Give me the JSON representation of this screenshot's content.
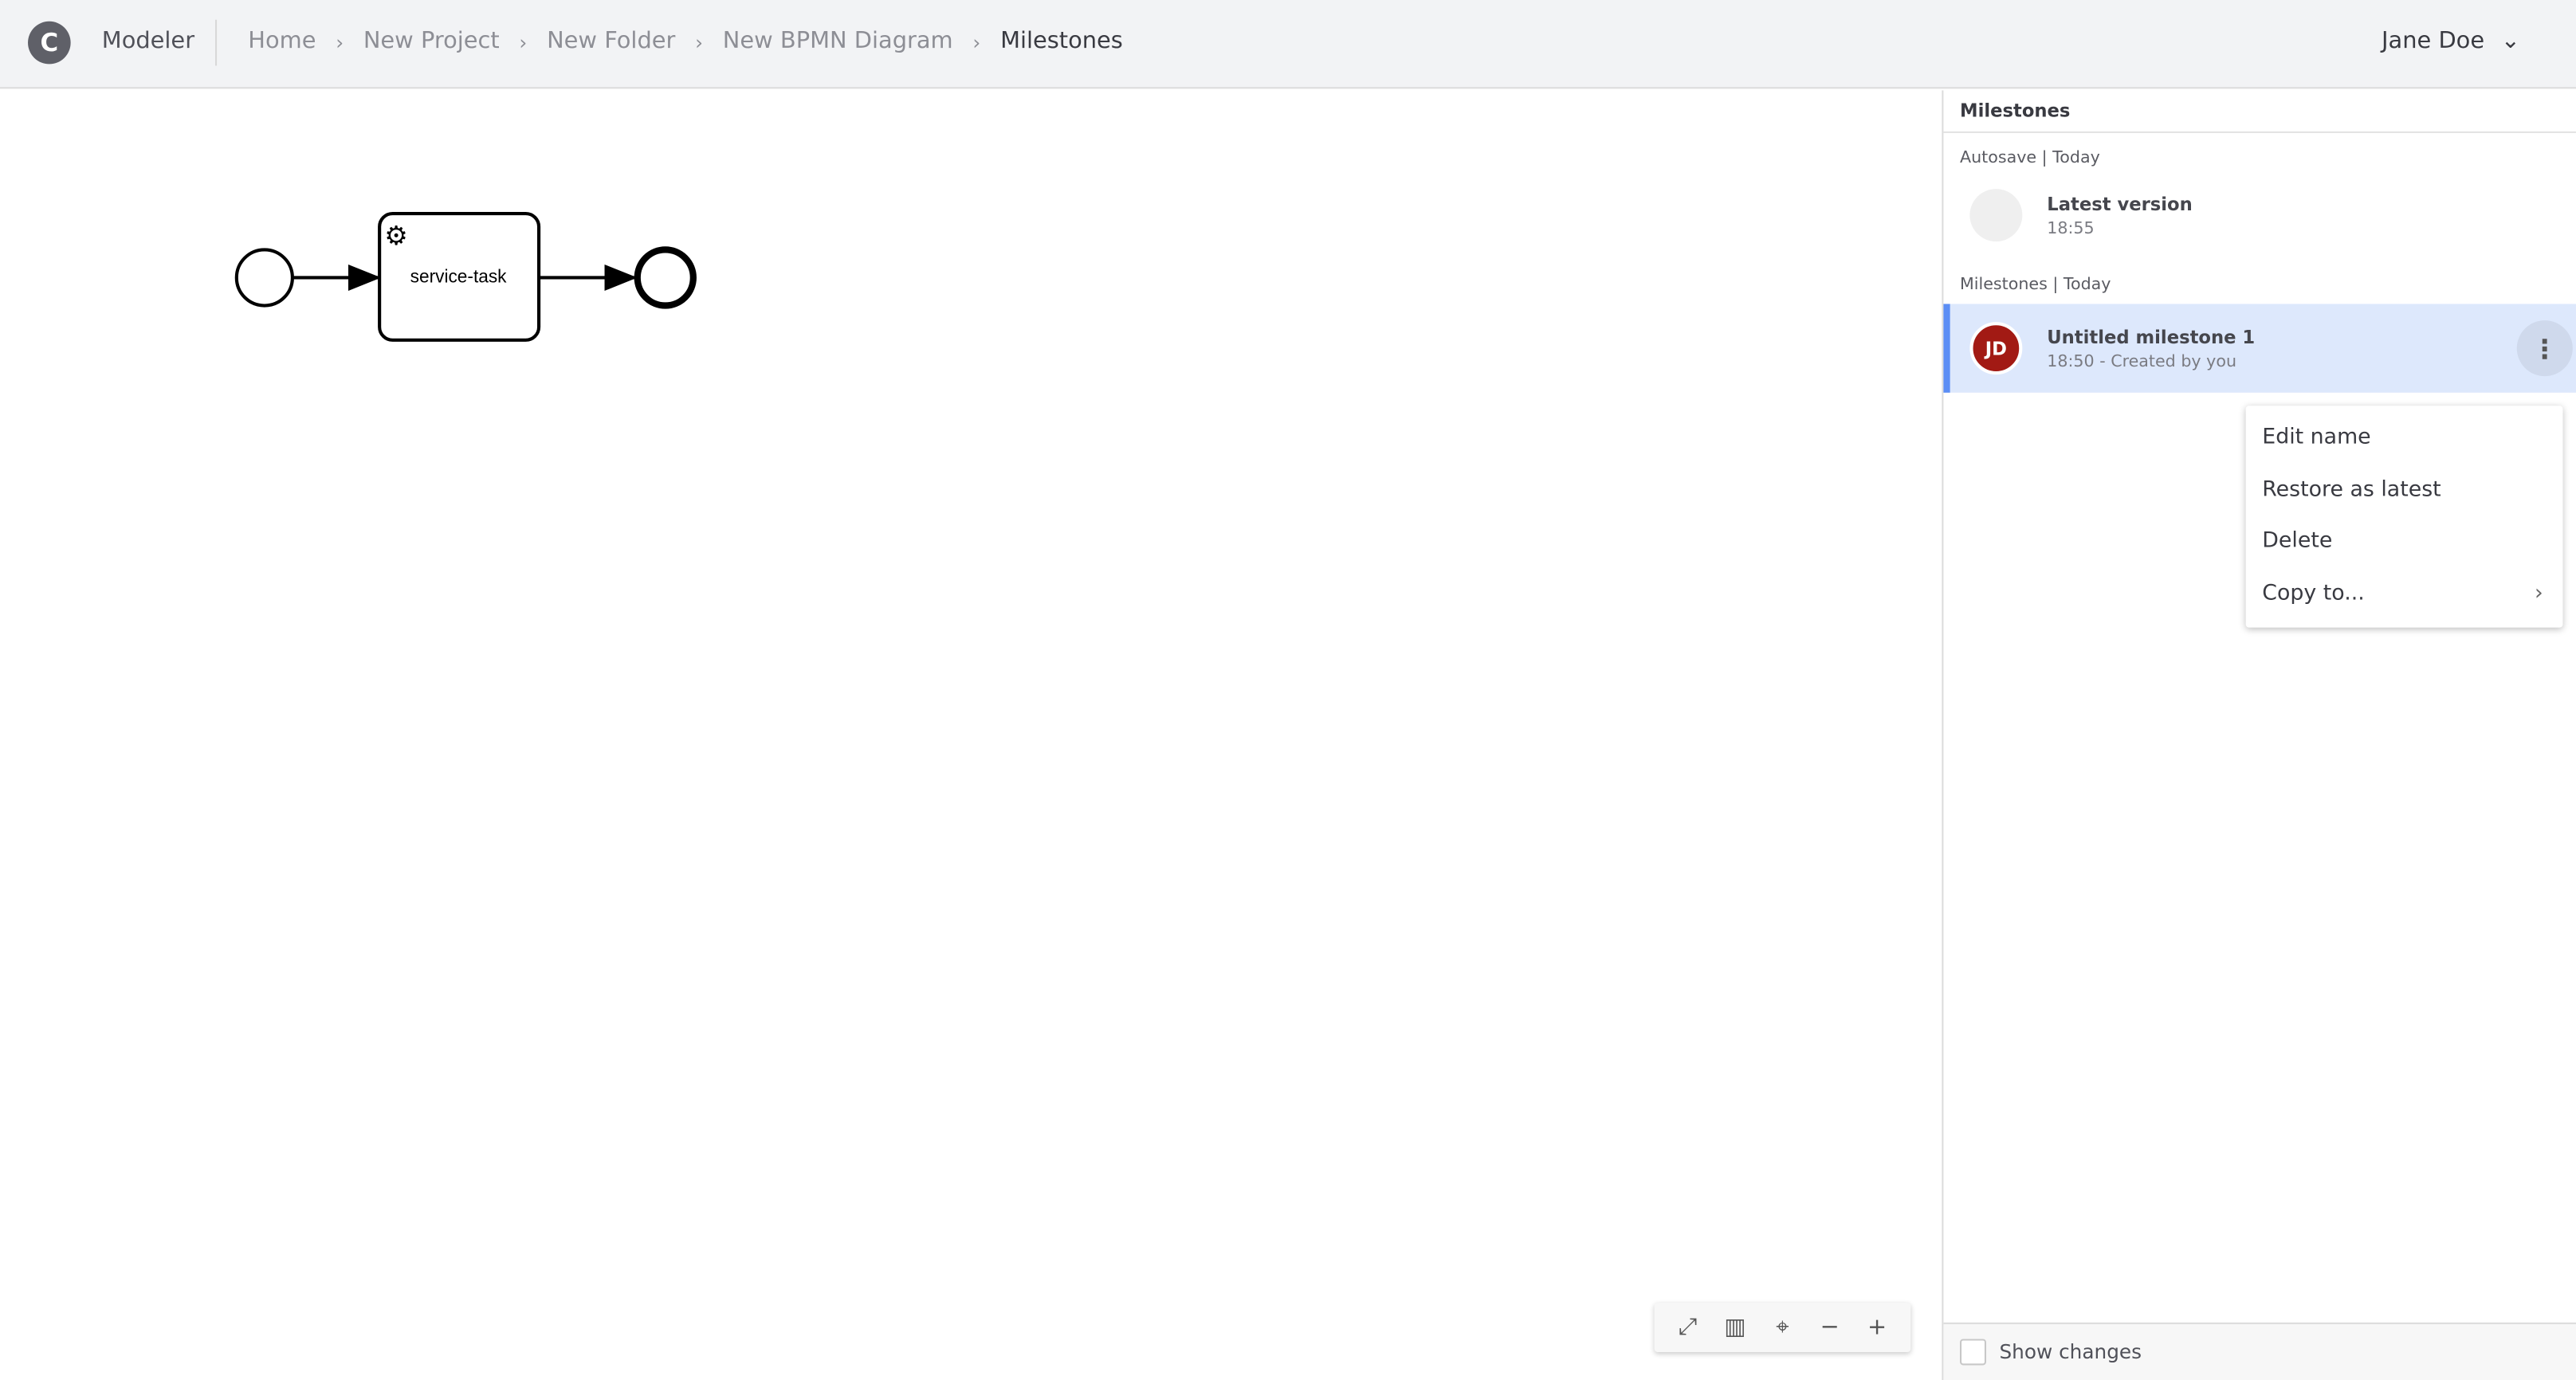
{
  "header": {
    "logo": "C",
    "app_name": "Modeler",
    "breadcrumbs": [
      "Home",
      "New Project",
      "New Folder",
      "New BPMN Diagram",
      "Milestones"
    ],
    "user_name": "Jane Doe"
  },
  "diagram": {
    "task_label": "service-task"
  },
  "panel": {
    "title": "Milestones",
    "autosave_section": "Autosave | Today",
    "latest": {
      "title": "Latest version",
      "time": "18:55"
    },
    "milestones_section": "Milestones | Today",
    "milestone": {
      "initials": "JD",
      "title": "Untitled milestone 1",
      "subtitle": "18:50 - Created by you",
      "avatar_color": "#a21a14"
    },
    "menu": [
      "Edit name",
      "Restore as latest",
      "Delete",
      "Copy to..."
    ],
    "show_changes": "Show changes"
  },
  "colors": {
    "accent": "#5c8ef5",
    "selected_bg": "#dde8fc"
  },
  "toolbar_icons": [
    "fullscreen-icon",
    "map-icon",
    "crosshair-icon",
    "zoom-out-icon",
    "zoom-in-icon"
  ]
}
